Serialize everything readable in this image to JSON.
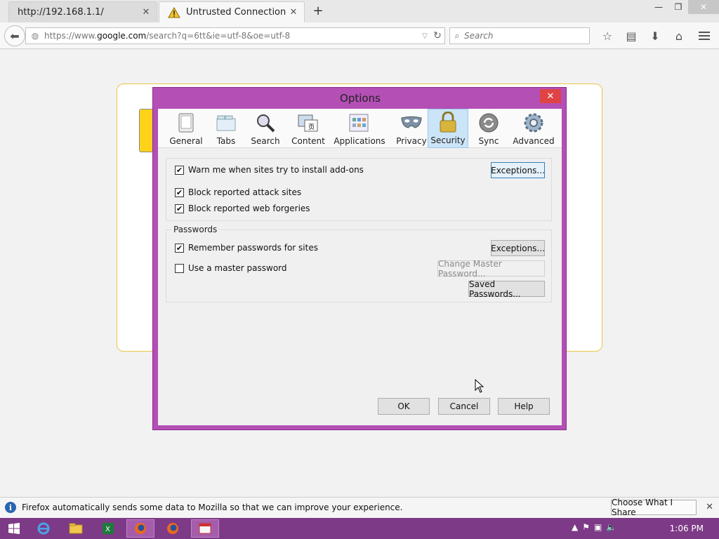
{
  "browser": {
    "tabs": [
      {
        "title": "http://192.168.1.1/",
        "active": false
      },
      {
        "title": "Untrusted Connection",
        "active": true,
        "icon": "warning-icon"
      }
    ],
    "url": {
      "prefix": "https://www.",
      "domain": "google.com",
      "path": "/search?q=6tt&ie=utf-8&oe=utf-8"
    },
    "search_placeholder": "Search"
  },
  "dialog": {
    "title": "Options",
    "panes": [
      {
        "label": "General",
        "icon": "general-icon"
      },
      {
        "label": "Tabs",
        "icon": "tabs-icon"
      },
      {
        "label": "Search",
        "icon": "search-icon"
      },
      {
        "label": "Content",
        "icon": "content-icon"
      },
      {
        "label": "Applications",
        "icon": "applications-icon"
      },
      {
        "label": "Privacy",
        "icon": "privacy-mask-icon"
      },
      {
        "label": "Security",
        "icon": "padlock-icon",
        "selected": true
      },
      {
        "label": "Sync",
        "icon": "sync-icon"
      },
      {
        "label": "Advanced",
        "icon": "gear-icon"
      }
    ],
    "general": {
      "warn_addons": {
        "label": "Warn me when sites try to install add-ons",
        "checked": true
      },
      "block_attack": {
        "label": "Block reported attack sites",
        "checked": true
      },
      "block_forgeries": {
        "label": "Block reported web forgeries",
        "checked": true
      },
      "exceptions_label": "Exceptions..."
    },
    "passwords": {
      "legend": "Passwords",
      "remember": {
        "label": "Remember passwords for sites",
        "checked": true
      },
      "master": {
        "label": "Use a master password",
        "checked": false
      },
      "exceptions_label": "Exceptions...",
      "change_master_label": "Change Master Password...",
      "saved_label": "Saved Passwords..."
    },
    "buttons": {
      "ok": "OK",
      "cancel": "Cancel",
      "help": "Help"
    }
  },
  "notification": {
    "message": "Firefox automatically sends some data to Mozilla so that we can improve your experience.",
    "action": "Choose What I Share"
  },
  "taskbar": {
    "clock": "1:06 PM"
  },
  "colors": {
    "dialog_frame": "#b34fb5",
    "taskbar": "#7d3a86",
    "selected_pane": "#cce4f7"
  }
}
